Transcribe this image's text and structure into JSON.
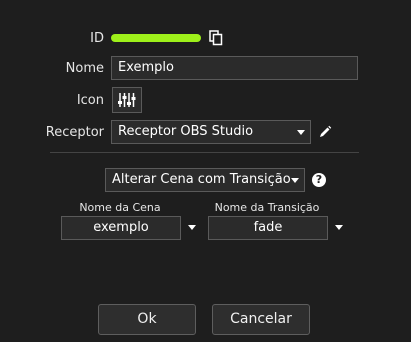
{
  "form": {
    "id": {
      "label": "ID",
      "highlight_color": "#9ef01a"
    },
    "name": {
      "label": "Nome",
      "value": "Exemplo"
    },
    "icon": {
      "label": "Icon",
      "icon_name": "sliders-icon"
    },
    "receiver": {
      "label": "Receptor",
      "selected": "Receptor OBS Studio",
      "edit_icon": "pencil-icon"
    }
  },
  "action": {
    "selected": "Alterar Cena com Transição",
    "help_icon": "help-icon",
    "help_glyph": "?"
  },
  "scene": {
    "label": "Nome da Cena",
    "value": "exemplo"
  },
  "transition": {
    "label": "Nome da Transição",
    "value": "fade"
  },
  "buttons": {
    "ok": "Ok",
    "cancel": "Cancelar"
  },
  "colors": {
    "background": "#1e1e1e",
    "field_border": "#5a5a5a",
    "id_highlight": "#9ef01a"
  }
}
